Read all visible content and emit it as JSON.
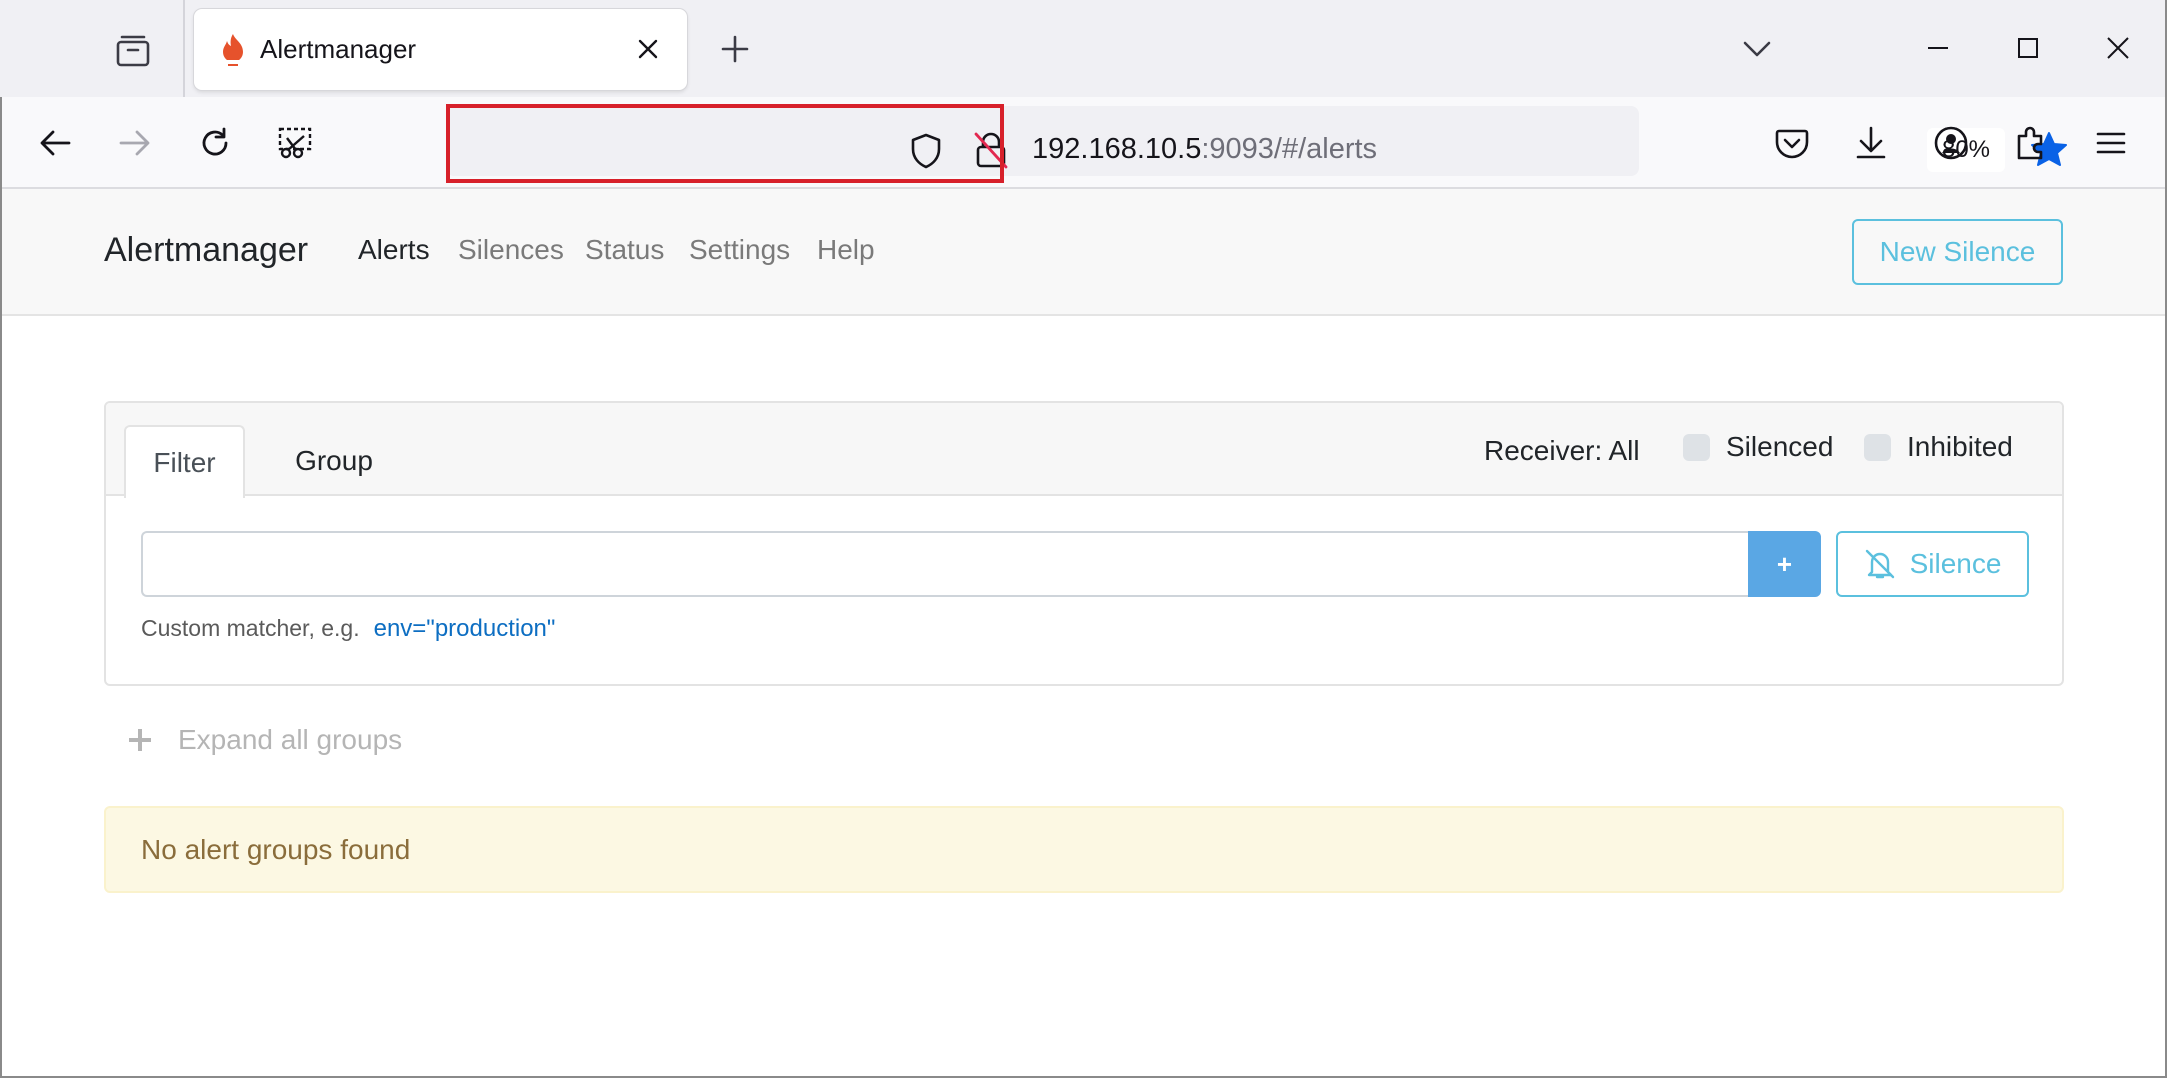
{
  "browser": {
    "tab_title": "Alertmanager",
    "url_host": "192.168.10.5",
    "url_path": ":9093/#/alerts",
    "zoom": "80%"
  },
  "icons": {
    "tab_collection": "tab-collection-icon",
    "favicon": "alertmanager-flame-icon",
    "tab_close": "close-icon",
    "new_tab": "plus-icon",
    "tab_list": "chevron-down-icon",
    "minimize": "minimize-icon",
    "maximize": "maximize-icon",
    "close_window": "close-icon",
    "back": "back-arrow-icon",
    "forward": "forward-arrow-icon",
    "reload": "reload-icon",
    "screenshot": "screenshot-icon",
    "tracking": "shield-icon",
    "insecure": "insecure-lock-icon",
    "bookmark": "star-icon",
    "pocket": "pocket-icon",
    "downloads": "download-icon",
    "account": "account-icon",
    "extensions": "puzzle-icon",
    "menu": "hamburger-icon",
    "silence": "bell-slash-icon",
    "expand": "plus-icon"
  },
  "app": {
    "brand": "Alertmanager",
    "nav": {
      "alerts": "Alerts",
      "silences": "Silences",
      "status": "Status",
      "settings": "Settings",
      "help": "Help"
    },
    "new_silence": "New Silence"
  },
  "filter": {
    "tab_filter": "Filter",
    "tab_group": "Group",
    "receiver": "Receiver: All",
    "silenced_label": "Silenced",
    "inhibited_label": "Inhibited",
    "silenced_checked": false,
    "inhibited_checked": false,
    "input_value": "",
    "add_button": "+",
    "silence_button": "Silence",
    "hint_text": "Custom matcher, e.g.",
    "hint_example": "env=\"production\""
  },
  "groups": {
    "expand_all": "Expand all groups",
    "empty_message": "No alert groups found"
  },
  "colors": {
    "accent_info": "#5bc0de",
    "primary": "#5aa7e4",
    "warning_bg": "#fcf8e3",
    "warning_text": "#8a6d3b",
    "url_highlight": "#d7202a",
    "bookmark_star": "#0a62e6"
  }
}
